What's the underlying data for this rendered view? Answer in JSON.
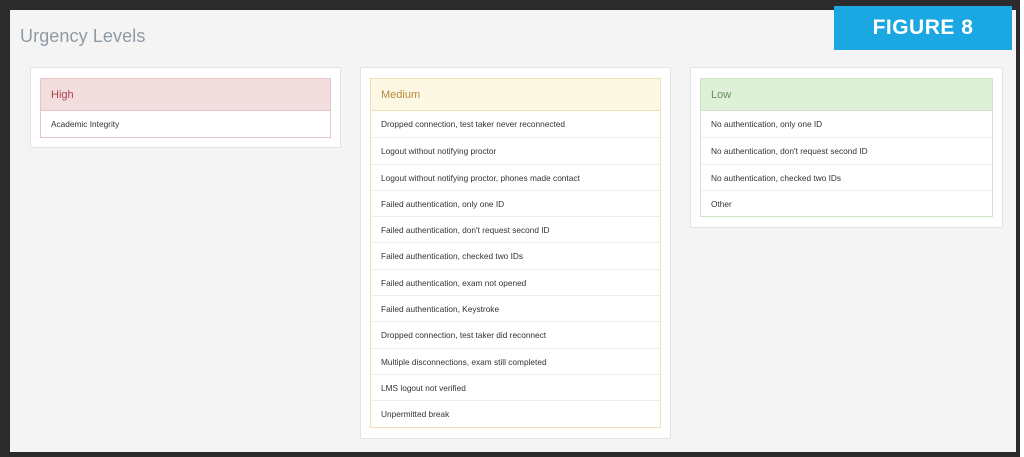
{
  "page": {
    "title": "Urgency Levels",
    "figure_label": "FIGURE 8"
  },
  "colors": {
    "badge": "#1ba7e1",
    "high_bg": "#f2dede",
    "medium_bg": "#fcf8e3",
    "low_bg": "#dff0d8",
    "title_text": "#8e9aa3"
  },
  "panels": {
    "high": {
      "heading": "High",
      "items": [
        "Academic Integrity"
      ]
    },
    "medium": {
      "heading": "Medium",
      "items": [
        "Dropped connection, test taker never reconnected",
        "Logout without notifying proctor",
        "Logout without notifying proctor, phones made contact",
        "Failed authentication, only one ID",
        "Failed authentication, don't request second ID",
        "Failed authentication, checked two IDs",
        "Failed authentication, exam not opened",
        "Failed authentication, Keystroke",
        "Dropped connection, test taker did reconnect",
        "Multiple disconnections, exam still completed",
        "LMS logout not verified",
        "Unpermitted break"
      ]
    },
    "low": {
      "heading": "Low",
      "items": [
        "No authentication, only one ID",
        "No authentication, don't request second ID",
        "No authentication, checked two IDs",
        "Other"
      ]
    }
  }
}
